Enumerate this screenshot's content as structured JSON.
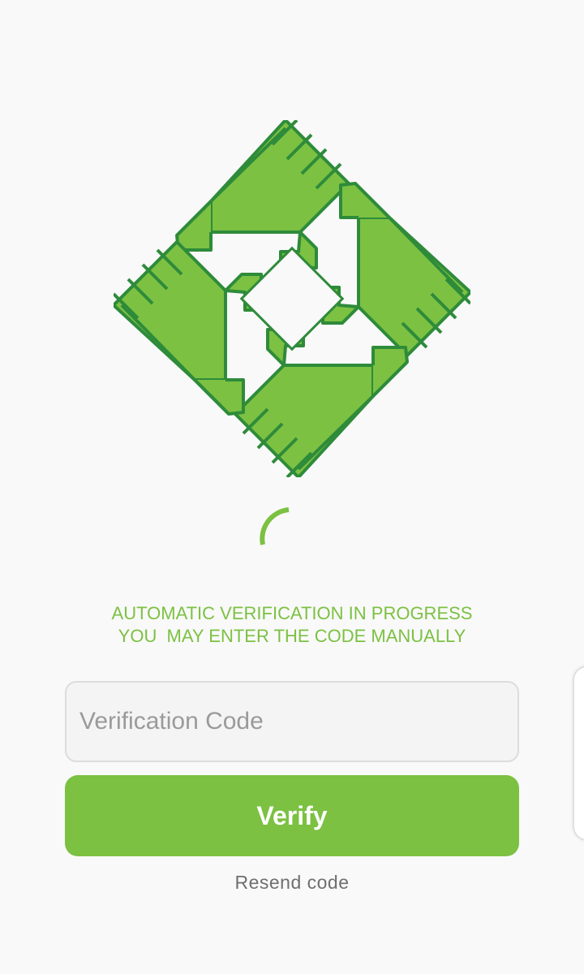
{
  "logo": {
    "icon": "four-hands-diamond-logo",
    "fill_color": "#7cc142",
    "stroke_color": "#2e8b3a"
  },
  "spinner": {
    "icon": "loading-spinner",
    "color": "#7cc142"
  },
  "status": {
    "line1": "AUTOMATIC VERIFICATION IN PROGRESS",
    "line2": "YOU  MAY ENTER THE CODE MANUALLY",
    "color": "#7cc142"
  },
  "code_input": {
    "placeholder": "Verification Code",
    "value": ""
  },
  "verify_button": {
    "label": "Verify",
    "color": "#7cc142"
  },
  "resend": {
    "label": "Resend code"
  }
}
